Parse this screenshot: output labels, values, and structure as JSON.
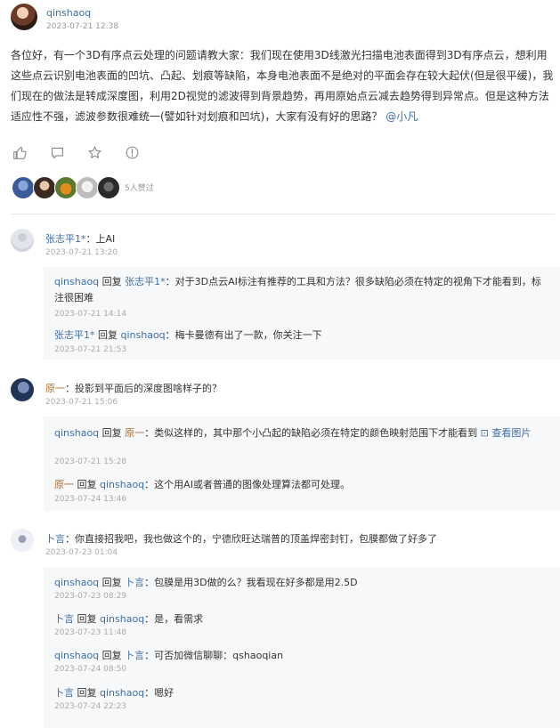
{
  "post": {
    "author": "qinshaoq",
    "time": "2023-07-21 12:38",
    "body": "各位好，有一个3D有序点云处理的问题请教大家：我们现在使用3D线激光扫描电池表面得到3D有序点云，想利用这些点云识别电池表面的凹坑、凸起、划痕等缺陷，本身电池表面不是绝对的平面会存在较大起伏(但是很平缓)，我们现在的做法是转成深度图，利用2D视觉的滤波得到背景趋势，再用原始点云减去趋势得到异常点。但是这种方法适应性不强，滤波参数很难统一(譬如针对划痕和凹坑)，大家有没有好的思路？",
    "mention": "@小凡",
    "likes_text": "5人赞过"
  },
  "actions": [
    "like-icon",
    "comment-icon",
    "favorite-icon",
    "report-icon"
  ],
  "comments": [
    {
      "author": "张志平1*",
      "sep": "：",
      "text": "上AI",
      "time": "2023-07-21 13:20",
      "replies": [
        {
          "from": "qinshaoq",
          "verb": " 回复 ",
          "to": "张志平1*",
          "text": "：对于3D点云AI标注有推荐的工具和方法？很多缺陷必须在特定的视角下才能看到，标注很困难",
          "time": "2023-07-21 14:14"
        },
        {
          "from": "张志平1*",
          "verb": " 回复 ",
          "to": "qinshaoq",
          "text": "：梅卡曼德有出了一款，你关注一下",
          "time": "2023-07-21 21:53"
        }
      ]
    },
    {
      "author": "原一",
      "sep": "：",
      "text": "投影到平面后的深度图啥样子的？",
      "time": "2023-07-21 15:06",
      "replies": [
        {
          "from": "qinshaoq",
          "verb": " 回复 ",
          "to": "原一",
          "text": "：类似这样的，其中那个小凸起的缺陷必须在特定的颜色映射范围下才能看到 ",
          "link": "⊡ 查看图片",
          "time": "2023-07-21 15:28"
        },
        {
          "from": "原一",
          "verb": " 回复 ",
          "to": "qinshaoq",
          "text": "：这个用AI或者普通的图像处理算法都可处理。",
          "time": "2023-07-24 13:46"
        }
      ]
    },
    {
      "author": "卜言",
      "sep": "：",
      "text": "你直接招我吧，我也做这个的，宁德欣旺达瑞普的顶盖焊密封钉，包膜都做了好多了",
      "time": "2023-07-23 01:04",
      "replies": [
        {
          "from": "qinshaoq",
          "verb": " 回复 ",
          "to": "卜言",
          "text": "：包膜是用3D做的么？我看现在好多都是用2.5D",
          "time": "2023-07-23 08:29"
        },
        {
          "from": "卜言",
          "verb": " 回复 ",
          "to": "qinshaoq",
          "text": "：是，看需求",
          "time": "2023-07-23 11:48"
        },
        {
          "from": "qinshaoq",
          "verb": " 回复 ",
          "to": "卜言",
          "text": "：可否加微信聊聊：qshaoqian",
          "time": "2023-07-24 08:50"
        },
        {
          "from": "卜言",
          "verb": " 回复 ",
          "to": "qinshaoq",
          "text": "：嗯好",
          "time": "2023-07-24 22:23"
        }
      ]
    }
  ],
  "colors": {
    "link": "#3d6ea8",
    "orange_user": "#b36a2a",
    "reply_bg": "#f7f8fa",
    "muted": "#999999"
  }
}
